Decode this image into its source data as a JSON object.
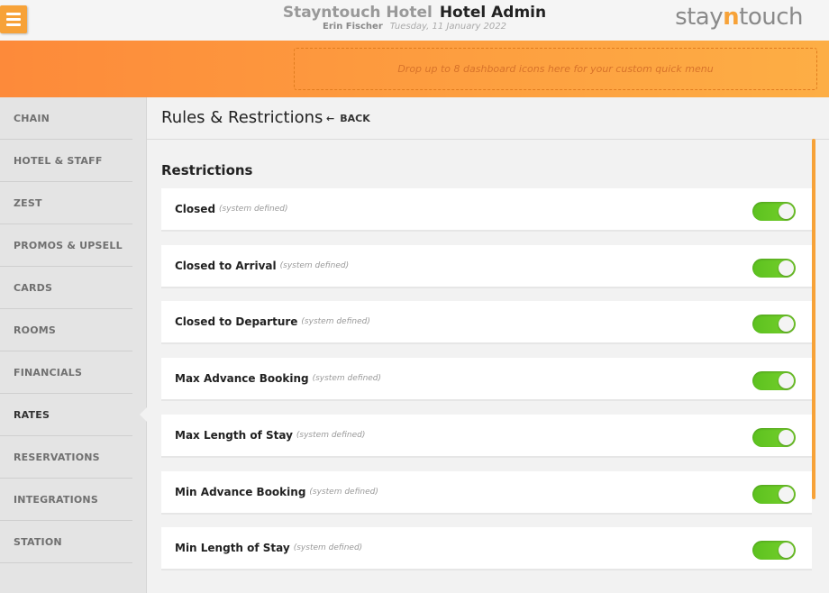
{
  "header": {
    "menu_icon": "hamburger-icon",
    "hotel_name": "Stayntouch Hotel",
    "app_name": "Hotel Admin",
    "user_name": "Erin Fischer",
    "date": "Tuesday, 11 January 2022",
    "logo": {
      "part1": "stay",
      "part2": "n",
      "part3": "touch"
    }
  },
  "quick_menu": {
    "placeholder": "Drop up to 8 dashboard icons here for your custom quick menu"
  },
  "sidebar": {
    "items": [
      {
        "label": "CHAIN"
      },
      {
        "label": "HOTEL & STAFF"
      },
      {
        "label": "ZEST"
      },
      {
        "label": "PROMOS & UPSELL"
      },
      {
        "label": "CARDS"
      },
      {
        "label": "ROOMS"
      },
      {
        "label": "FINANCIALS"
      },
      {
        "label": "RATES",
        "active": true
      },
      {
        "label": "RESERVATIONS"
      },
      {
        "label": "INTEGRATIONS"
      },
      {
        "label": "STATION"
      }
    ]
  },
  "main": {
    "page_title": "Rules & Restrictions",
    "back_label": "BACK",
    "back_icon": "arrow-left-icon",
    "section_title": "Restrictions",
    "restrictions": [
      {
        "name": "Closed",
        "note": "(system defined)",
        "enabled": true
      },
      {
        "name": "Closed to Arrival",
        "note": "(system defined)",
        "enabled": true
      },
      {
        "name": "Closed to Departure",
        "note": "(system defined)",
        "enabled": true
      },
      {
        "name": "Max Advance Booking",
        "note": "(system defined)",
        "enabled": true
      },
      {
        "name": "Max Length of Stay",
        "note": "(system defined)",
        "enabled": true
      },
      {
        "name": "Min Advance Booking",
        "note": "(system defined)",
        "enabled": true
      },
      {
        "name": "Min Length of Stay",
        "note": "(system defined)",
        "enabled": true
      }
    ]
  },
  "colors": {
    "accent_orange": "#f7a238",
    "toggle_on": "#6ac926"
  }
}
